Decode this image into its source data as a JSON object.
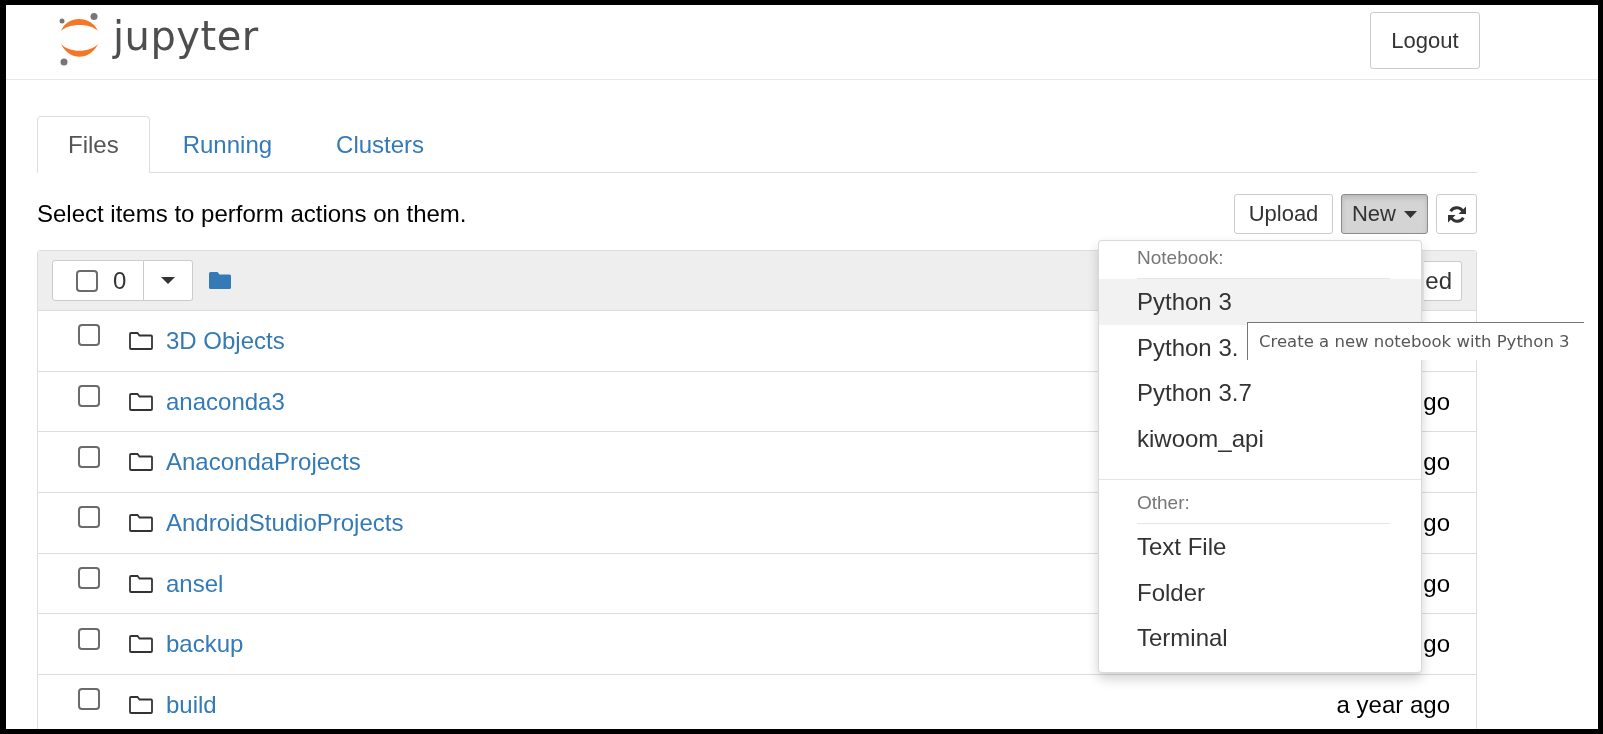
{
  "header": {
    "logo_text": "jupyter",
    "logout_button": "Logout"
  },
  "tabs": [
    {
      "label": "Files",
      "selected": true
    },
    {
      "label": "Running",
      "selected": false
    },
    {
      "label": "Clusters",
      "selected": false
    }
  ],
  "toolbar": {
    "hint": "Select items to perform actions on them.",
    "upload_button": "Upload",
    "new_button": {
      "label": "New",
      "open": true
    }
  },
  "new_menu": {
    "sections": [
      {
        "header": "Notebook:",
        "items": [
          {
            "label": "Python 3",
            "selected": true
          },
          {
            "label": "Python 3.",
            "selected": false
          },
          {
            "label": "Python 3.7",
            "selected": false
          },
          {
            "label": "kiwoom_api",
            "selected": false
          }
        ]
      },
      {
        "header": "Other:",
        "items": [
          {
            "label": "Text File",
            "selected": false
          },
          {
            "label": "Folder",
            "selected": false
          },
          {
            "label": "Terminal",
            "selected": false
          }
        ]
      }
    ]
  },
  "tooltip": {
    "text": "Create a new notebook with Python 3"
  },
  "file_list": {
    "select_all": {
      "checked": false,
      "count": "0"
    },
    "column_button": "ed",
    "rows": [
      {
        "name": "3D Objects",
        "checked": false
      },
      {
        "name": "anaconda3",
        "checked": false,
        "modified": "go"
      },
      {
        "name": "AnacondaProjects",
        "checked": false,
        "modified": "go"
      },
      {
        "name": "AndroidStudioProjects",
        "checked": false,
        "modified": "go"
      },
      {
        "name": "ansel",
        "checked": false,
        "modified": "go"
      },
      {
        "name": "backup",
        "checked": false,
        "modified": "go"
      },
      {
        "name": "build",
        "checked": false,
        "modified": "a year ago"
      }
    ]
  }
}
